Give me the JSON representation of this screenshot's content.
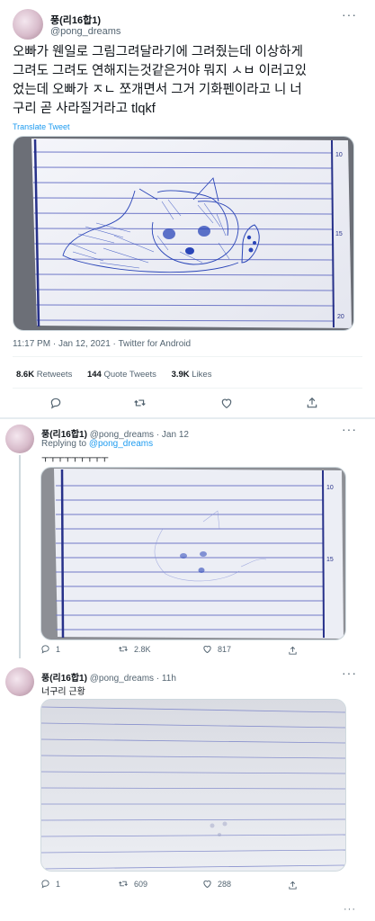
{
  "tweet1": {
    "author": "풍(리16합1)",
    "handle": "@pong_dreams",
    "text_line1": "오빠가 웬일로 그림그려달라기에 그려줬는데 이상하게",
    "text_line2": "그려도 그려도 연해지는것같은거야 뭐지 ㅅㅂ 이러고있",
    "text_line3": "었는데 오빠가 ㅈㄴ 쪼개면서 그거 기화펜이라고 니 너",
    "text_line4": "구리 곧 사라질거라고 tlqkf",
    "translate": "Translate Tweet",
    "timestamp": "11:17 PM · Jan 12, 2021 · Twitter for Android",
    "retweets_count": "8.6K",
    "retweets_label": "Retweets",
    "quotes_count": "144",
    "quotes_label": "Quote Tweets",
    "likes_count": "3.9K",
    "likes_label": "Likes",
    "page_numbers": [
      "10",
      "15",
      "20"
    ]
  },
  "tweet2": {
    "author": "풍(리16합1)",
    "handle": "@pong_dreams",
    "time": "· Jan 12",
    "replying_prefix": "Replying to",
    "replying_handle": "@pong_dreams",
    "text": "ㅜㅜㅜㅜㅜㅜㅜㅜㅜ",
    "replies": "1",
    "retweets": "2.8K",
    "likes": "817",
    "page_numbers": [
      "10",
      "15"
    ]
  },
  "tweet3": {
    "author": "풍(리16합1)",
    "handle": "@pong_dreams",
    "time": "· 11h",
    "text": "너구리 근황",
    "replies": "1",
    "retweets": "609",
    "likes": "288"
  },
  "icons": [
    "more-icon",
    "reply-icon",
    "retweet-icon",
    "like-icon",
    "share-icon"
  ],
  "colors": {
    "link": "#1d9bf0",
    "muted": "#536471",
    "ink": "#2a45b8",
    "ruled_line": "#6f78c8"
  }
}
